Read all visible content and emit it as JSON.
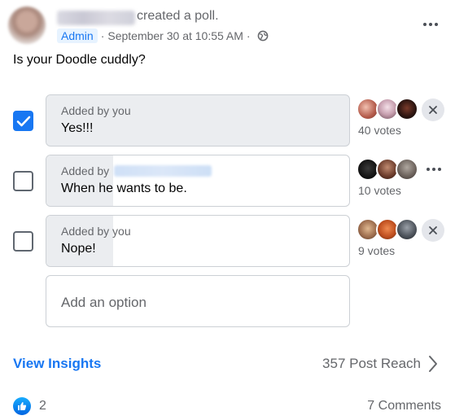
{
  "post": {
    "action": "created a poll.",
    "role_badge": "Admin",
    "separator": "·",
    "timestamp": "September 30 at 10:55 AM",
    "audience_icon": "globe-icon",
    "more_icon": "more-horizontal-icon"
  },
  "poll": {
    "question": "Is your Doodle cuddly?",
    "options": [
      {
        "added_by": "Added by you",
        "text": "Yes!!!",
        "checked": true,
        "votes_label": "40 votes",
        "votes_fraction": 0.25,
        "action_icon": "close-icon"
      },
      {
        "added_by": "Added by",
        "text": "When he wants to be.",
        "checked": false,
        "votes_label": "10 votes",
        "votes_fraction": 0.22,
        "action_icon": "more-horizontal-icon"
      },
      {
        "added_by": "Added by you",
        "text": "Nope!",
        "checked": false,
        "votes_label": "9 votes",
        "votes_fraction": 0.22,
        "action_icon": "close-icon"
      }
    ],
    "add_option_placeholder": "Add an option"
  },
  "footer": {
    "insights_label": "View Insights",
    "reach_label": "357 Post Reach",
    "likes_count": "2",
    "comments_label": "7 Comments"
  },
  "colors": {
    "accent": "#1877f2",
    "secondary_text": "#65676b",
    "option_border": "#ccd0d5",
    "option_fill": "#ebedf0"
  }
}
